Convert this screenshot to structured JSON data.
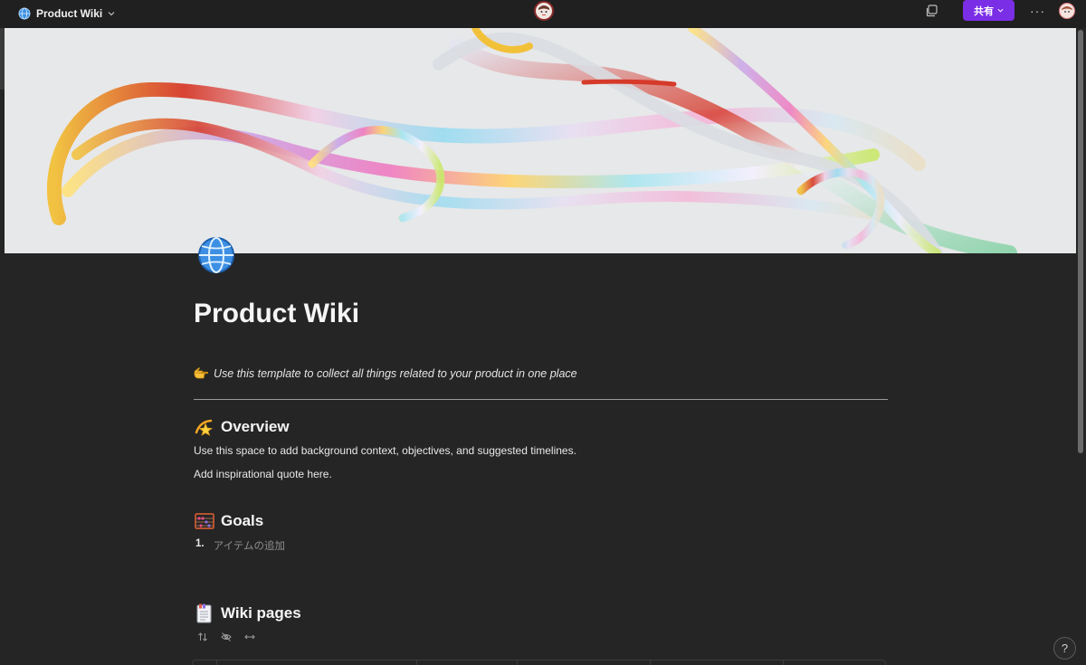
{
  "topbar": {
    "title": "Product Wiki",
    "share_label": "共有",
    "more_label": "···"
  },
  "page": {
    "title": "Product Wiki",
    "callout": "Use this template to collect all things related to your product in one place"
  },
  "overview": {
    "heading": "Overview",
    "lines": [
      "Use this space to add background context, objectives, and suggested timelines.",
      "Add inspirational quote here."
    ]
  },
  "goals": {
    "heading": "Goals",
    "items": [
      {
        "number": "1.",
        "placeholder": "アイテムの追加"
      }
    ]
  },
  "wiki": {
    "heading": "Wiki pages"
  },
  "help": {
    "label": "?"
  },
  "colors": {
    "background": "#252525",
    "topbar": "#202020",
    "accent": "#7a2ee6",
    "text": "#e8e8e8",
    "placeholder": "#8e8e8e"
  },
  "icons": {
    "workspace": "globe-icon",
    "page": "globe-icon",
    "callout": "pointing-hand-icon",
    "overview": "dizzy-star-icon",
    "goals": "abacus-icon",
    "wiki": "bookmark-tabs-icon",
    "sort": "sort-icon",
    "hide": "eye-off-icon",
    "width": "horizontal-arrows-icon"
  }
}
